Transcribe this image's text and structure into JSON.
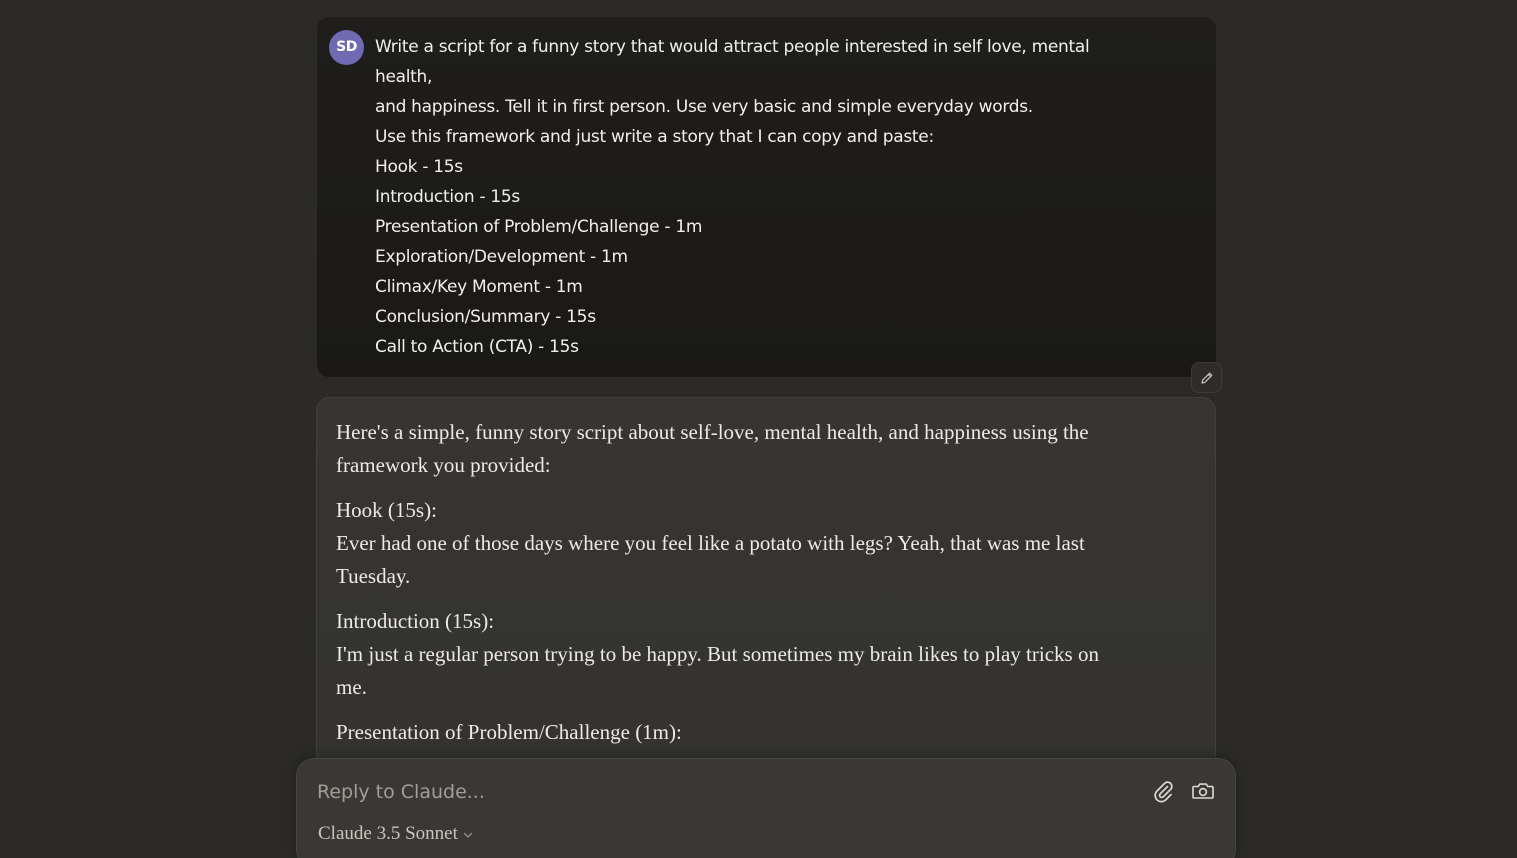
{
  "user_message": {
    "avatar_initials": "SD",
    "avatar_color": "#6f6ab2",
    "lines": [
      "Write a script for a funny story that would attract people interested in self love, mental",
      "health,",
      "and happiness. Tell it in first person. Use very basic and simple everyday words.",
      "Use this framework and just write a story that I can copy and paste:",
      "Hook - 15s",
      "Introduction - 15s",
      "Presentation of Problem/Challenge - 1m",
      "Exploration/Development - 1m",
      "Climax/Key Moment - 1m",
      "Conclusion/Summary - 15s",
      "Call to Action (CTA) - 15s"
    ],
    "edit_icon": "pencil-icon"
  },
  "assistant_message": {
    "intro_lines": [
      "Here's a simple, funny story script about self-love, mental health, and happiness using the",
      "framework you provided:"
    ],
    "hook_heading": "Hook (15s):",
    "hook_lines": [
      "Ever had one of those days where you feel like a potato with legs? Yeah, that was me last",
      "Tuesday."
    ],
    "intro_heading": "Introduction (15s):",
    "introduction_lines": [
      "I'm just a regular person trying to be happy. But sometimes my brain likes to play tricks on",
      "me."
    ],
    "problem_heading": "Presentation of Problem/Challenge (1m):"
  },
  "composer": {
    "placeholder": "Reply to Claude...",
    "attach_icon": "paperclip-icon",
    "camera_icon": "camera-icon",
    "model_label": "Claude 3.5 Sonnet",
    "model_icon": "chevron-down-icon"
  },
  "colors": {
    "background": "#2b2a27",
    "user_bubble": "#1f1e1c",
    "assistant_bubble": "#363532",
    "composer": "#393835"
  }
}
